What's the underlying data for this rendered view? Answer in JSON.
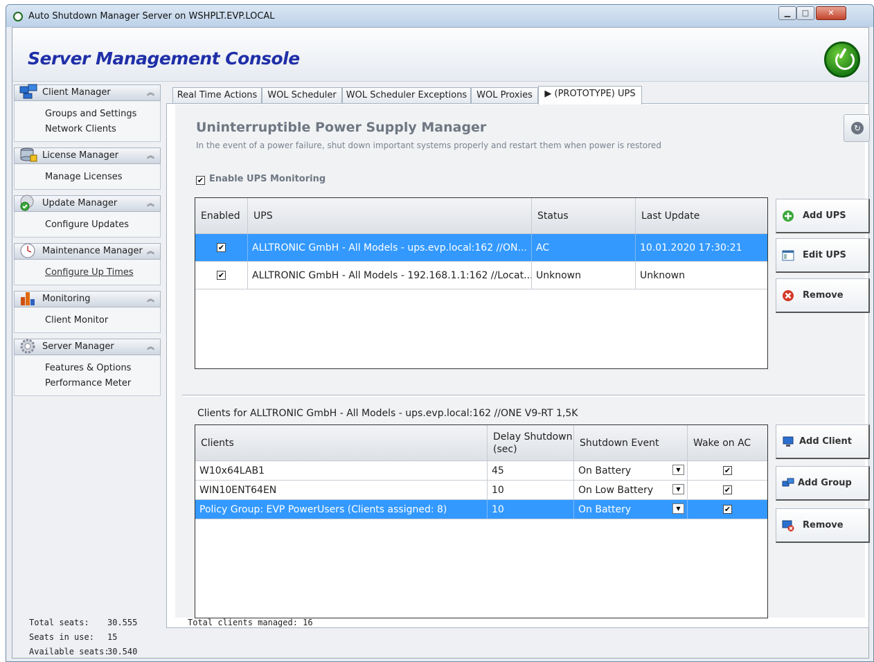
{
  "window": {
    "title": "Auto Shutdown Manager Server on WSHPLT.EVP.LOCAL"
  },
  "header": {
    "title": "Server Management Console"
  },
  "sidebar": {
    "groups": [
      {
        "label": "Client Manager",
        "links": [
          "Groups and Settings",
          "Network Clients"
        ]
      },
      {
        "label": "License Manager",
        "links": [
          "Manage Licenses"
        ]
      },
      {
        "label": "Update  Manager",
        "links": [
          "Configure Updates"
        ]
      },
      {
        "label": "Maintenance Manager",
        "links": [
          "Configure Up Times"
        ]
      },
      {
        "label": "Monitoring",
        "links": [
          "Client Monitor"
        ]
      },
      {
        "label": "Server Manager",
        "links": [
          "Features & Options",
          "Performance Meter"
        ]
      }
    ]
  },
  "tabs": [
    "Real Time Actions",
    "WOL Scheduler",
    "WOL Scheduler Exceptions",
    "WOL Proxies",
    "▶ (PROTOTYPE) UPS"
  ],
  "ups": {
    "title": "Uninterruptible Power Supply Manager",
    "subtitle": "In the event of a power failure, shut down important systems properly and restart them when power is restored",
    "enable_label": "Enable UPS Monitoring",
    "enable_checked": true,
    "columns": [
      "Enabled",
      "UPS",
      "Status",
      "Last Update"
    ],
    "rows": [
      {
        "enabled": "✔",
        "ups": "ALLTRONIC GmbH - All Models - ups.evp.local:162 //ON...",
        "status": "AC",
        "last_update": "10.01.2020 17:30:21",
        "selected": true
      },
      {
        "enabled": "✔",
        "ups": "ALLTRONIC GmbH - All Models - 192.168.1.1:162 //Locat...",
        "status": "Unknown",
        "last_update": "Unknown",
        "selected": false
      }
    ],
    "buttons": {
      "add": "Add UPS",
      "edit": "Edit UPS",
      "remove": "Remove"
    }
  },
  "clients": {
    "label": "Clients for ALLTRONIC GmbH - All Models - ups.evp.local:162 //ONE V9-RT 1,5K",
    "columns": [
      "Clients",
      "Delay Shutdown (sec)",
      "Shutdown Event",
      "Wake on AC"
    ],
    "rows": [
      {
        "client": "W10x64LAB1",
        "delay": "45",
        "event": "On Battery",
        "wake": "✔",
        "selected": false
      },
      {
        "client": "WIN10ENT64EN",
        "delay": "10",
        "event": "On Low Battery",
        "wake": "✔",
        "selected": false
      },
      {
        "client": "Policy Group: EVP PowerUsers (Clients assigned: 8)",
        "delay": "10",
        "event": "On Battery",
        "wake": "✔",
        "selected": true
      }
    ],
    "buttons": {
      "add_client": "Add Client",
      "add_group": "Add Group",
      "remove": "Remove"
    }
  },
  "status": {
    "total_seats_label": "Total seats:",
    "total_seats": "30.555",
    "seats_in_use_label": "Seats in use:",
    "seats_in_use": "15",
    "available_label": "Available seats:",
    "available": "30.540",
    "total_clients": "Total clients managed: 16"
  }
}
